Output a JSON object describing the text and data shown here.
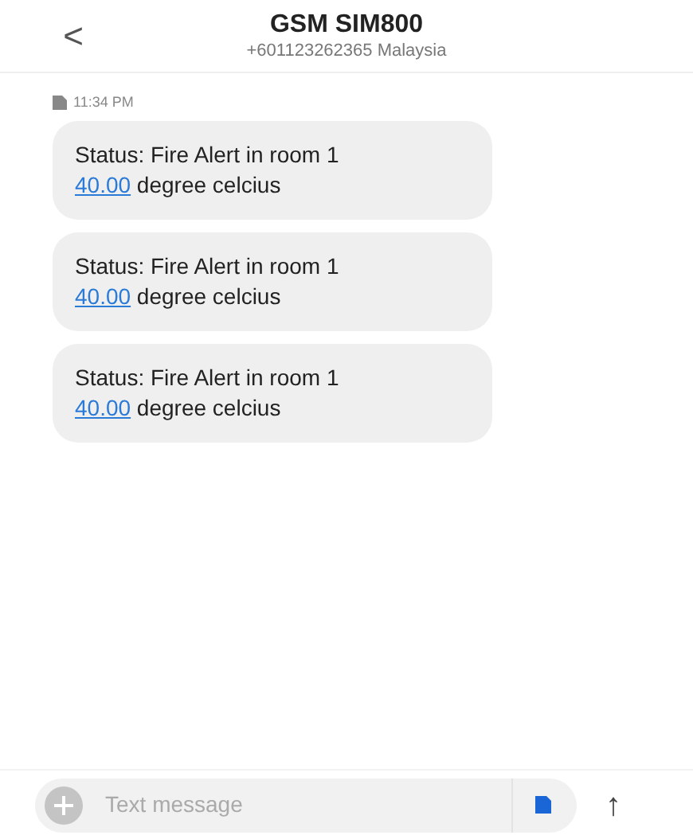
{
  "header": {
    "back": "<",
    "title": "GSM SIM800",
    "subtitle": "+601123262365 Malaysia"
  },
  "timestamp": "11:34 PM",
  "messages": [
    {
      "line": "Status: Fire Alert in room 1",
      "link": "40.00",
      "rest": " degree celcius"
    },
    {
      "line": "Status: Fire Alert in room 1",
      "link": "40.00",
      "rest": " degree celcius"
    },
    {
      "line": "Status: Fire Alert in room 1",
      "link": "40.00",
      "rest": " degree celcius"
    }
  ],
  "composer": {
    "placeholder": "Text message",
    "send": "↑"
  }
}
